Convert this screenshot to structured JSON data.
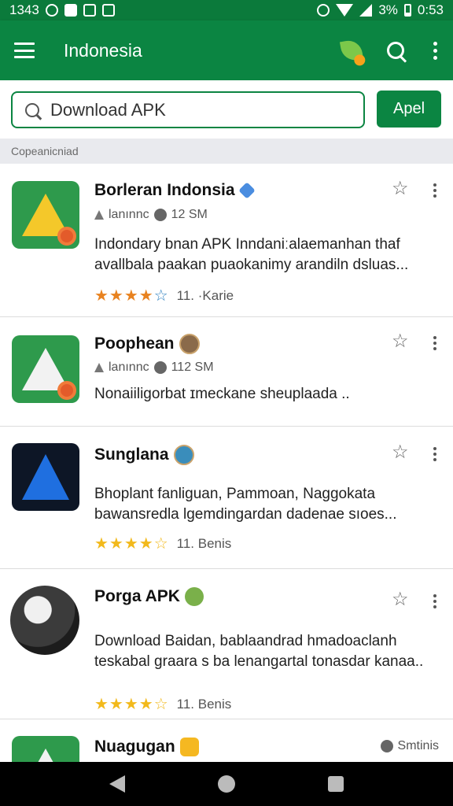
{
  "status_bar": {
    "time_left": "1343",
    "battery": "3%",
    "clock": "0:53"
  },
  "app_bar": {
    "title": "Indonesia",
    "icons": [
      "menu-icon",
      "leaf-icon",
      "search-icon",
      "more-vert-icon"
    ]
  },
  "search": {
    "value": "Download APK",
    "button_label": "Apel"
  },
  "section": {
    "header": "Copeanicniad"
  },
  "items": [
    {
      "title": "Borleran Indonsia",
      "meta_author": "lanınnc",
      "meta_size": "12 SM",
      "description": "Indondary bnan APK Inndaniːalaemanhan thaf avallbala paakan puaokanimy arandiln dsluas...",
      "rating_text": "11. ·Karie",
      "stars_filled": 4,
      "badge": "verified-icon"
    },
    {
      "title": "Poophean",
      "meta_author": "lanınnc",
      "meta_size": "112 SM",
      "description": "Nonaiiligorbat ɪmeckane sheuplaada ..",
      "badge": "avatar-icon"
    },
    {
      "title": "Sunglana",
      "description": "Bhoplant fanliguan, Pammoan, Naggokata bawansredla lgemdingardan dadenae sıoes...",
      "rating_text": "11. Benis",
      "stars_filled": 4,
      "badge": "avatar-icon"
    },
    {
      "title": "Porga APK",
      "description": "Download Baidan, bablaandrad hmadoaclanh teskabal graara s ba lenangartal tonasdar kanaa..",
      "rating_text": "11. Benis",
      "stars_filled": 4,
      "badge": "emoji-icon"
    },
    {
      "title": "Nuagugan",
      "meta_size": "Smtinis",
      "badge": "emoji-icon"
    }
  ],
  "nav": {
    "icons": [
      "back-icon",
      "home-icon",
      "recent-apps-icon"
    ]
  },
  "colors": {
    "primary": "#0b8542",
    "star_orange": "#e8821f",
    "star_gold": "#f2b91b"
  }
}
